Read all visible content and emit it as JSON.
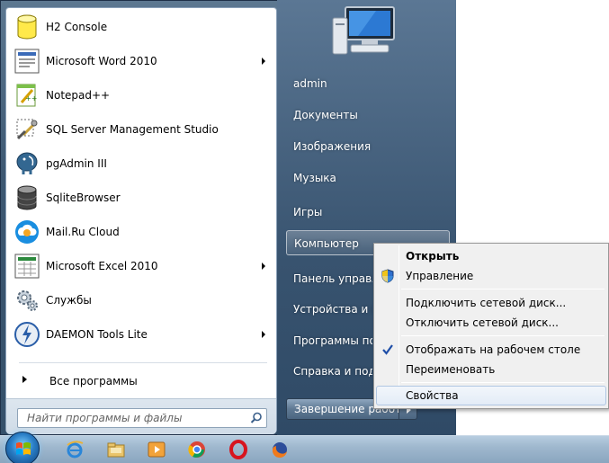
{
  "start_menu": {
    "programs": [
      {
        "label": "H2 Console",
        "icon": "h2-database-icon",
        "has_submenu": false
      },
      {
        "label": "Microsoft Word 2010",
        "icon": "word-icon",
        "has_submenu": true
      },
      {
        "label": "Notepad++",
        "icon": "notepad-plus-plus-icon",
        "has_submenu": false
      },
      {
        "label": "SQL Server Management Studio",
        "icon": "ssms-icon",
        "has_submenu": false
      },
      {
        "label": "pgAdmin III",
        "icon": "pgadmin-elephant-icon",
        "has_submenu": false
      },
      {
        "label": "SqliteBrowser",
        "icon": "sqlite-database-icon",
        "has_submenu": false
      },
      {
        "label": "Mail.Ru Cloud",
        "icon": "mailru-cloud-icon",
        "has_submenu": false
      },
      {
        "label": "Microsoft Excel 2010",
        "icon": "excel-icon",
        "has_submenu": true
      },
      {
        "label": "Службы",
        "icon": "services-gears-icon",
        "has_submenu": false
      },
      {
        "label": "DAEMON Tools Lite",
        "icon": "daemon-tools-icon",
        "has_submenu": true
      }
    ],
    "all_programs_label": "Все программы",
    "search_placeholder": "Найти программы и файлы",
    "right_items": [
      {
        "label": "admin"
      },
      {
        "label": "Документы"
      },
      {
        "label": "Изображения"
      },
      {
        "label": "Музыка"
      },
      {
        "label": "Игры"
      },
      {
        "label": "Компьютер",
        "active": true
      },
      {
        "label": "Панель управления"
      },
      {
        "label": "Устройства и принтеры"
      },
      {
        "label": "Программы по умолчанию"
      },
      {
        "label": "Справка и поддержка"
      }
    ],
    "shutdown_label": "Завершение работы"
  },
  "context_menu": {
    "items": [
      {
        "label": "Открыть",
        "bold": true
      },
      {
        "label": "Управление",
        "icon": "uac-shield-icon"
      },
      {
        "label": "Подключить сетевой диск..."
      },
      {
        "label": "Отключить сетевой диск..."
      },
      {
        "label": "Отображать на рабочем столе",
        "checked": true
      },
      {
        "label": "Переименовать"
      },
      {
        "label": "Свойства",
        "hover": true
      }
    ]
  },
  "taskbar": {
    "icons": [
      "start-orb-icon",
      "internet-explorer-icon",
      "windows-explorer-icon",
      "media-player-icon",
      "chrome-icon",
      "opera-icon",
      "firefox-icon"
    ]
  }
}
